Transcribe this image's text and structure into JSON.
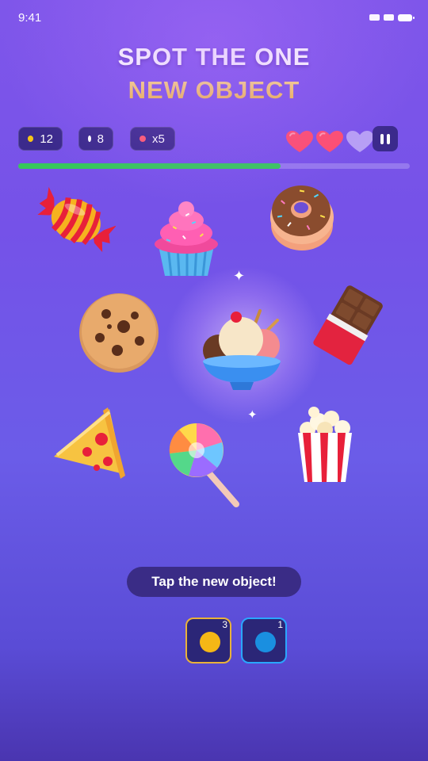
{
  "status_bar": {
    "time": "9:41"
  },
  "title": {
    "line1": "SPOT THE ONE",
    "line2": "NEW OBJECT"
  },
  "stats": {
    "coins": {
      "value": "12",
      "color": "#f5c518"
    },
    "pearls": {
      "value": "8",
      "color": "#ffffff"
    },
    "multiplier": {
      "value": "x5",
      "color": "#ff5a6e"
    }
  },
  "lives": {
    "total": 3,
    "remaining": 2,
    "full_color": "#ff4d6d",
    "empty_color": "#b7a0f5"
  },
  "progress": {
    "fraction": 0.67,
    "color": "#36c75b"
  },
  "objects": [
    {
      "name": "candy"
    },
    {
      "name": "cupcake"
    },
    {
      "name": "donut"
    },
    {
      "name": "cookie"
    },
    {
      "name": "ice-cream-sundae",
      "highlighted": true
    },
    {
      "name": "chocolate-bar"
    },
    {
      "name": "pizza-slice"
    },
    {
      "name": "lollipop"
    },
    {
      "name": "popcorn"
    }
  ],
  "hint": "Tap the new object!",
  "powerups": [
    {
      "name": "hint-powerup",
      "count": "3",
      "color": "#f5b716",
      "border": "#e9b23a"
    },
    {
      "name": "freeze-powerup",
      "count": "1",
      "color": "#1a8fe0",
      "border": "#2aa6ff"
    }
  ]
}
